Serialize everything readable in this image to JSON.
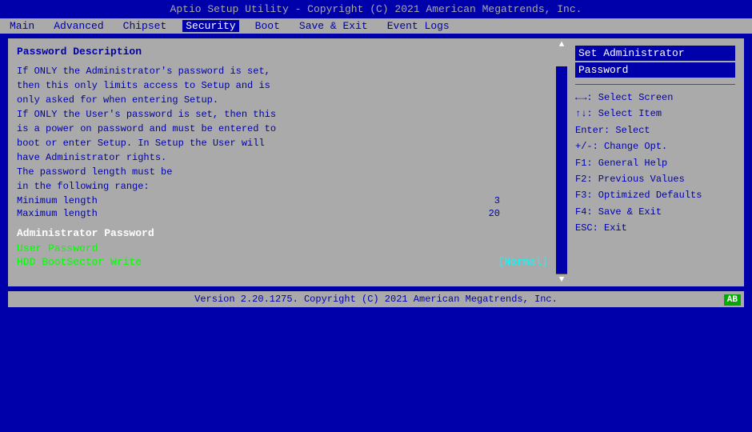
{
  "title_bar": {
    "text": "Aptio Setup Utility - Copyright (C) 2021 American Megatrends, Inc."
  },
  "menu": {
    "items": [
      {
        "label": "Main",
        "active": false
      },
      {
        "label": "Advanced",
        "active": false
      },
      {
        "label": "Chipset",
        "active": false
      },
      {
        "label": "Security",
        "active": true
      },
      {
        "label": "Boot",
        "active": false
      },
      {
        "label": "Save & Exit",
        "active": false
      },
      {
        "label": "Event Logs",
        "active": false
      }
    ]
  },
  "left_panel": {
    "section_title": "Password Description",
    "description_lines": [
      "If ONLY the Administrator's password is set,",
      "then this only limits access to Setup and is",
      "only asked for when entering Setup.",
      "If ONLY the User's password is set, then this",
      "is a power on password and must be entered to",
      "boot or enter Setup. In Setup the User will",
      "have Administrator rights.",
      "The password length must be",
      "in the following range:"
    ],
    "min_label": "Minimum length",
    "min_value": "3",
    "max_label": "Maximum length",
    "max_value": "20",
    "sub_heading": "Administrator Password",
    "user_password_label": "User Password",
    "hdd_label": "HDD BootSector Write",
    "hdd_value": "[Normal]"
  },
  "right_panel": {
    "selected_line1": "Set Administrator",
    "selected_line2": "Password",
    "help_items": [
      {
        "key": "←→:",
        "desc": "Select Screen"
      },
      {
        "key": "↑↓:",
        "desc": "Select Item"
      },
      {
        "key": "Enter:",
        "desc": "Select"
      },
      {
        "key": "+/-:",
        "desc": "Change Opt."
      },
      {
        "key": "F1:",
        "desc": "General Help"
      },
      {
        "key": "F2:",
        "desc": "Previous Values"
      },
      {
        "key": "F3:",
        "desc": "Optimized Defaults"
      },
      {
        "key": "F4:",
        "desc": "Save & Exit"
      },
      {
        "key": "ESC:",
        "desc": "Exit"
      }
    ]
  },
  "status_bar": {
    "text": "Version 2.20.1275. Copyright (C) 2021 American Megatrends, Inc.",
    "badge": "AB"
  }
}
